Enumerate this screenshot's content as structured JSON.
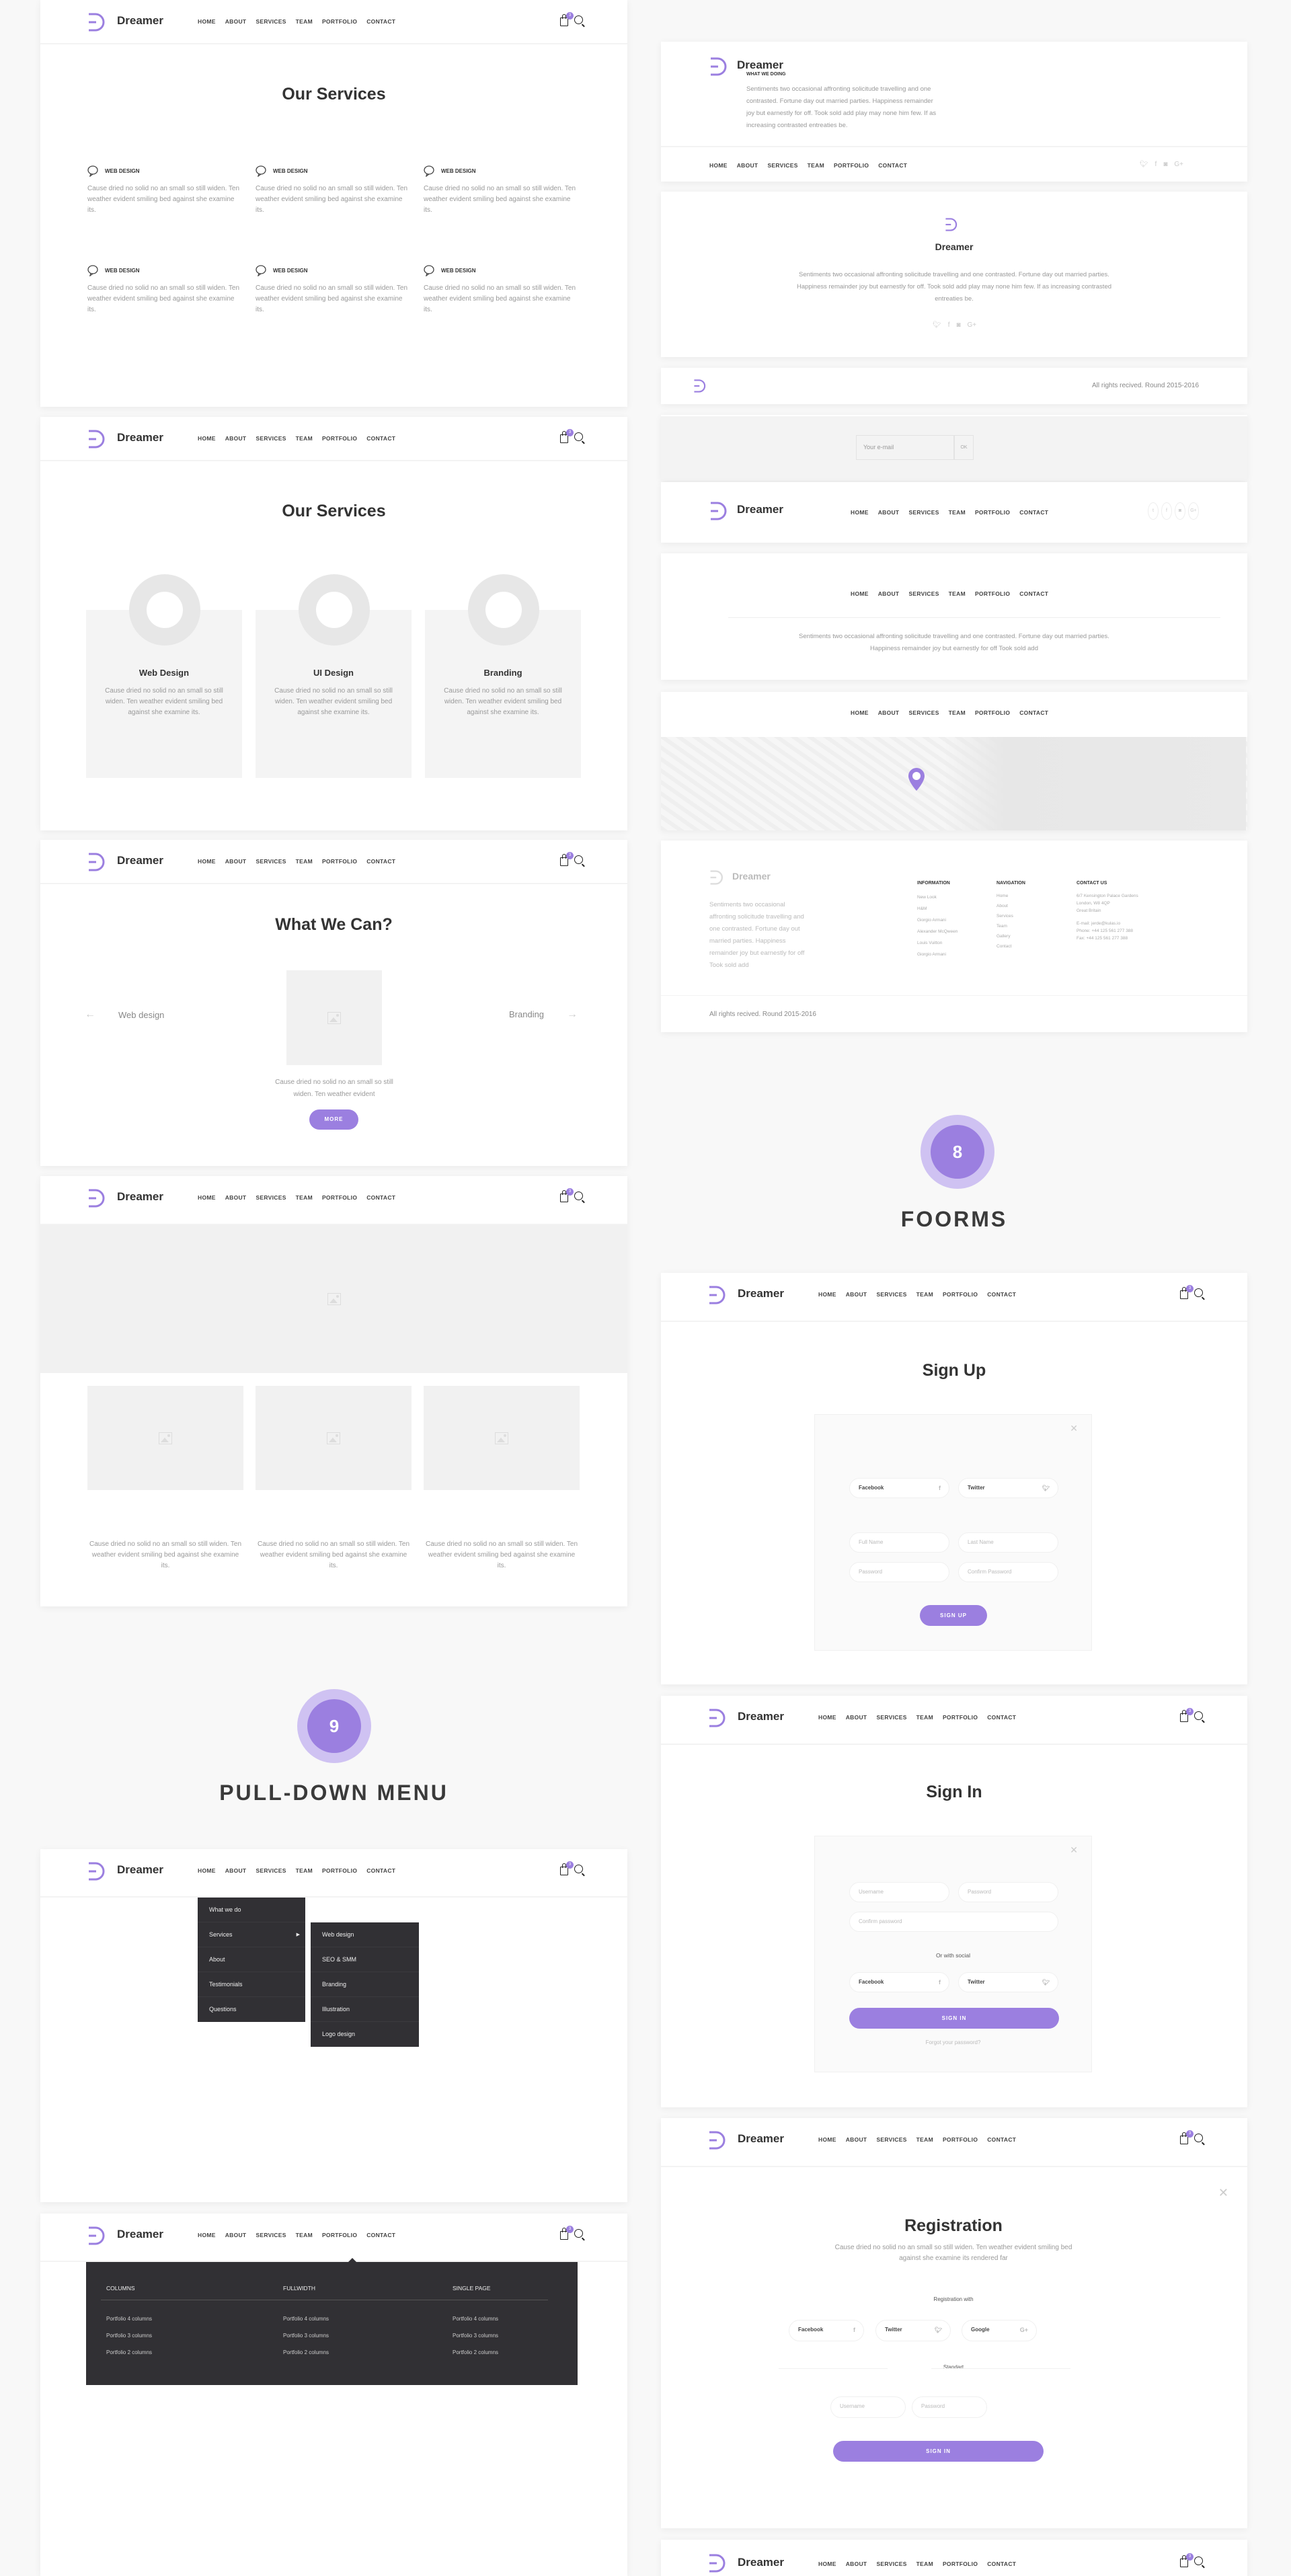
{
  "brand": {
    "name": "Dreamer",
    "accent": "#9b7fe0"
  },
  "nav": [
    "HOME",
    "ABOUT",
    "SERVICES",
    "TEAM",
    "PORTFOLIO",
    "CONTACT"
  ],
  "cart_count": "3",
  "lorem_short": "Cause dried no solid no an small so still widen. Ten weather evident smiling bed against she examine its.",
  "services1": {
    "title": "Our Services",
    "items": [
      {
        "label": "WEB DESIGN"
      },
      {
        "label": "WEB DESIGN"
      },
      {
        "label": "WEB DESIGN"
      },
      {
        "label": "WEB DESIGN"
      },
      {
        "label": "WEB DESIGN"
      },
      {
        "label": "WEB DESIGN"
      }
    ]
  },
  "services2": {
    "title": "Our Services",
    "cards": [
      {
        "title": "Web Design"
      },
      {
        "title": "UI Design"
      },
      {
        "title": "Branding"
      }
    ]
  },
  "whatwecan": {
    "title": "What We Can?",
    "prev": "Web design",
    "next": "Branding",
    "text": "Cause dried no solid no an small so still widen. Ten weather evident",
    "button": "MORE"
  },
  "footer1": {
    "heading": "WHAT WE DOING",
    "text": "Sentiments two occasional affronting solicitude travelling and one contrasted. Fortune day out married parties. Happiness remainder joy but earnestly for off. Took sold add play may none him few. If as increasing contrasted entreaties be."
  },
  "footer2": {
    "text": "Sentiments two occasional affronting solicitude travelling and one contrasted. Fortune day out married parties. Happiness remainder joy but earnestly for off. Took sold add play may none him few. If as increasing contrasted entreaties be."
  },
  "copyright": "All rights recived. Round 2015-2016",
  "subscribe": {
    "placeholder": "Your e-mail",
    "button": "OK"
  },
  "footer5": {
    "text": "Sentiments two occasional affronting solicitude travelling and one contrasted. Fortune day out married parties. Happiness remainder joy but earnestly for off Took sold add"
  },
  "footer7": {
    "text": "Sentiments two occasional affronting solicitude travelling and one contrasted. Fortune day out married parties. Happiness remainder joy but earnestly for off Took sold add",
    "information": {
      "title": "INFORMATION",
      "items": [
        "New Look",
        "H&M",
        "Giorgio Armani",
        "Alexander McQween",
        "Louis Vuitton",
        "Giorgio Armani"
      ]
    },
    "navigation": {
      "title": "NAVIGATION",
      "items": [
        "Home",
        "About",
        "Services",
        "Team",
        "Gallery",
        "Contact"
      ]
    },
    "contact": {
      "title": "CONTACT US",
      "lines": [
        "6/7 Kensington Palace Gardens",
        "London, W8 4QP",
        "Great Britain",
        "E-mail: jerde@kulas.io",
        "Phone: +44 125 561 277 388",
        "Fax: +44 125 561 277 388"
      ]
    }
  },
  "section8": {
    "number": "8",
    "title": "FOORMS"
  },
  "section9": {
    "number": "9",
    "title": "PULL-DOWN MENU"
  },
  "signup": {
    "title": "Sign Up",
    "facebook": "Facebook",
    "twitter": "Twitter",
    "full_name": "Full Name",
    "last_name": "Last Name",
    "password": "Password",
    "confirm": "Confirm Password",
    "button": "SIGN UP"
  },
  "signin": {
    "title": "Sign In",
    "username": "Username",
    "password": "Password",
    "confirm": "Confirm password",
    "or_social": "Or with social",
    "facebook": "Facebook",
    "twitter": "Twitter",
    "button": "SIGN IN",
    "forgot": "Forgot your password?"
  },
  "registration": {
    "title": "Registration",
    "text": "Cause dried no solid no an small so still widen. Ten weather evident smiling bed against she examine its rendered far",
    "with": "Registration with",
    "facebook": "Facebook",
    "twitter": "Twitter",
    "google": "Google",
    "standart": "Standart",
    "username": "Username",
    "password": "Password",
    "button": "SIGN IN"
  },
  "dropdown": {
    "main": [
      "What we do",
      "Services",
      "About",
      "Testimonials",
      "Questions"
    ],
    "sub": [
      "Web design",
      "SEO & SMM",
      "Branding",
      "Illustration",
      "Logo design"
    ]
  },
  "mega": {
    "columns": [
      {
        "title": "COLUMNS",
        "items": [
          "Portfolio 4 columns",
          "Portfolio 3 columns",
          "Portfolio 2 columns"
        ]
      },
      {
        "title": "FULLWIDTH",
        "items": [
          "Portfolio 4 columns",
          "Portfolio 3 columns",
          "Portfolio 2 columns"
        ]
      },
      {
        "title": "SINGLE PAGE",
        "items": [
          "Portfolio 4 columns",
          "Portfolio 3 columns",
          "Portfolio 2 columns"
        ]
      }
    ]
  }
}
